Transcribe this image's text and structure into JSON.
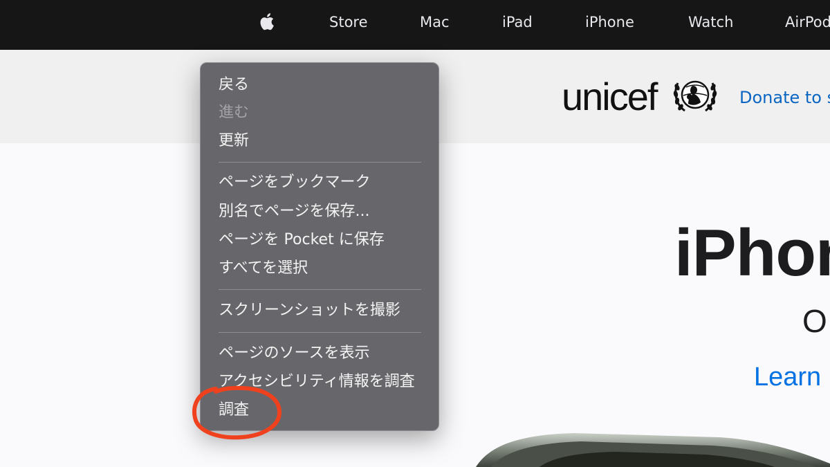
{
  "globalnav": {
    "logo_icon": "apple-logo-icon",
    "items": [
      "Store",
      "Mac",
      "iPad",
      "iPhone",
      "Watch",
      "AirPods"
    ]
  },
  "ribbon": {
    "logo_text": "unicef",
    "emblem_icon": "unicef-emblem-icon",
    "donate_text": "Donate to s"
  },
  "hero": {
    "title": "iPhon",
    "subtitle": "O",
    "link": "Learn m"
  },
  "context_menu": {
    "back": "戻る",
    "forward": "進む",
    "reload": "更新",
    "bookmark_page": "ページをブックマーク",
    "save_as": "別名でページを保存...",
    "save_to_pocket": "ページを Pocket に保存",
    "select_all": "すべてを選択",
    "take_screenshot": "スクリーンショットを撮影",
    "view_source": "ページのソースを表示",
    "inspect_accessibility": "アクセシビリティ情報を調査",
    "inspect": "調査"
  },
  "annotation": {
    "color": "#f0411e"
  },
  "colors": {
    "nav_bg": "#161616",
    "menu_bg": "#626266",
    "link_blue": "#0071e3"
  }
}
